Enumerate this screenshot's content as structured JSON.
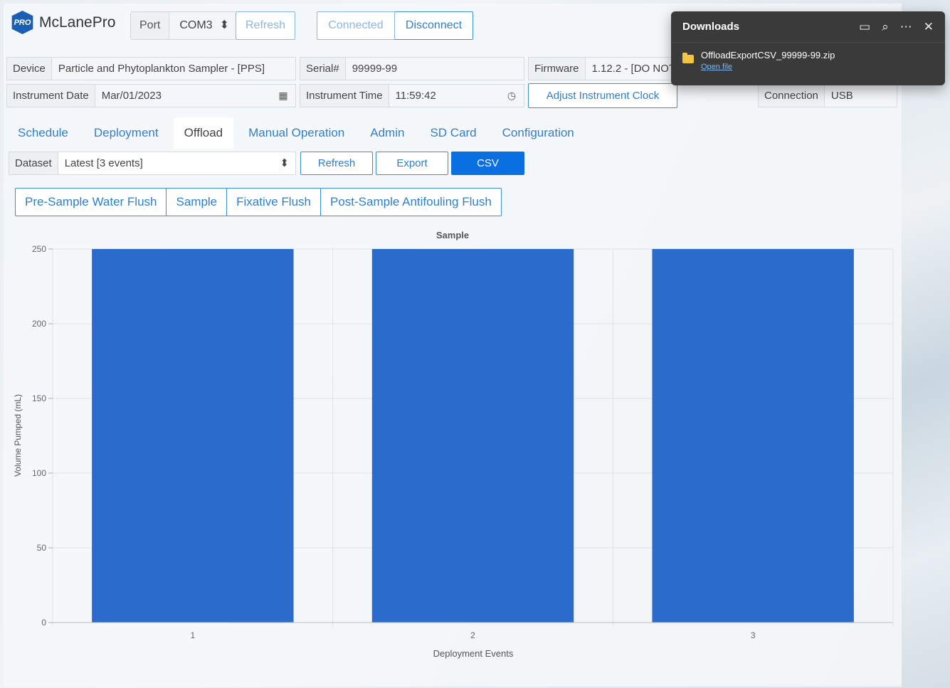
{
  "header": {
    "logo_mark": "PRO",
    "app_name": "McLanePro",
    "port_label": "Port",
    "port_value": "COM3",
    "refresh_label": "Refresh",
    "connected_label": "Connected",
    "disconnect_label": "Disconnect"
  },
  "info": {
    "device_label": "Device",
    "device_value": "Particle and Phytoplankton Sampler - [PPS]",
    "serial_label": "Serial#",
    "serial_value": "99999-99",
    "firmware_label": "Firmware",
    "firmware_value": "1.12.2 - [DO NOT",
    "date_label": "Instrument Date",
    "date_value": "Mar/01/2023",
    "time_label": "Instrument Time",
    "time_value": "11:59:42",
    "adjust_clock_label": "Adjust Instrument Clock",
    "connection_label": "Connection",
    "connection_value": "USB"
  },
  "tabs": [
    "Schedule",
    "Deployment",
    "Offload",
    "Manual Operation",
    "Admin",
    "SD Card",
    "Configuration"
  ],
  "active_tab": "Offload",
  "dataset": {
    "label": "Dataset",
    "value": "Latest [3 events]",
    "refresh_label": "Refresh",
    "export_label": "Export",
    "csv_label": "CSV"
  },
  "steps": [
    "Pre-Sample Water Flush",
    "Sample",
    "Fixative Flush",
    "Post-Sample Antifouling Flush"
  ],
  "downloads": {
    "title": "Downloads",
    "file_name": "OffloadExportCSV_99999-99.zip",
    "open_label": "Open file"
  },
  "colors": {
    "accent": "#2f7fce",
    "csv_button": "#0a6fe0",
    "bar": "#2b6bcc"
  },
  "chart_data": {
    "type": "bar",
    "title": "Sample",
    "xlabel": "Deployment Events",
    "ylabel": "Volume Pumped (mL)",
    "categories": [
      "1",
      "2",
      "3"
    ],
    "values": [
      250,
      250,
      250
    ],
    "ylim": [
      0,
      250
    ],
    "yticks": [
      0,
      50,
      100,
      150,
      200,
      250
    ],
    "grid": true
  }
}
